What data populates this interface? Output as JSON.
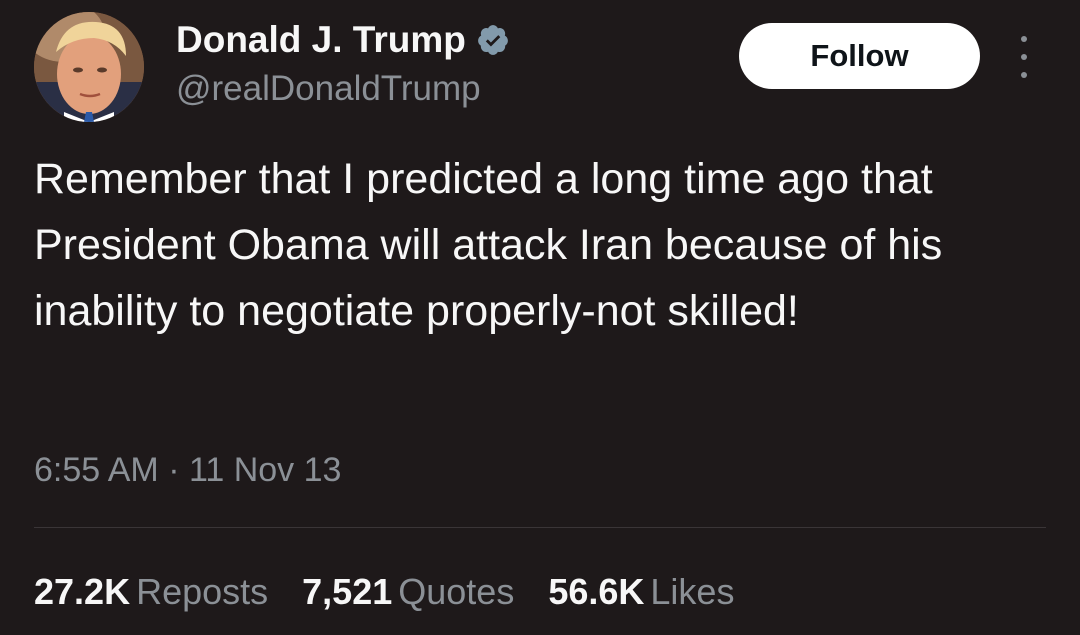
{
  "author": {
    "display_name": "Donald J. Trump",
    "handle": "@realDonaldTrump",
    "verified": true,
    "verified_color": "#829aab"
  },
  "actions": {
    "follow_label": "Follow",
    "more_icon": "more-vertical-icon"
  },
  "tweet": {
    "text": "Remember that I predicted a long time ago that President Obama will attack Iran because of his inability to negotiate properly-not skilled!",
    "timestamp": "6:55 AM · 11 Nov 13"
  },
  "stats": [
    {
      "count": "27.2K",
      "label": "Reposts"
    },
    {
      "count": "7,521",
      "label": "Quotes"
    },
    {
      "count": "56.6K",
      "label": "Likes"
    }
  ],
  "colors": {
    "background": "#1e191a",
    "text": "#f7f7f7",
    "secondary_text": "#8b9096",
    "follow_button_bg": "#ffffff"
  }
}
